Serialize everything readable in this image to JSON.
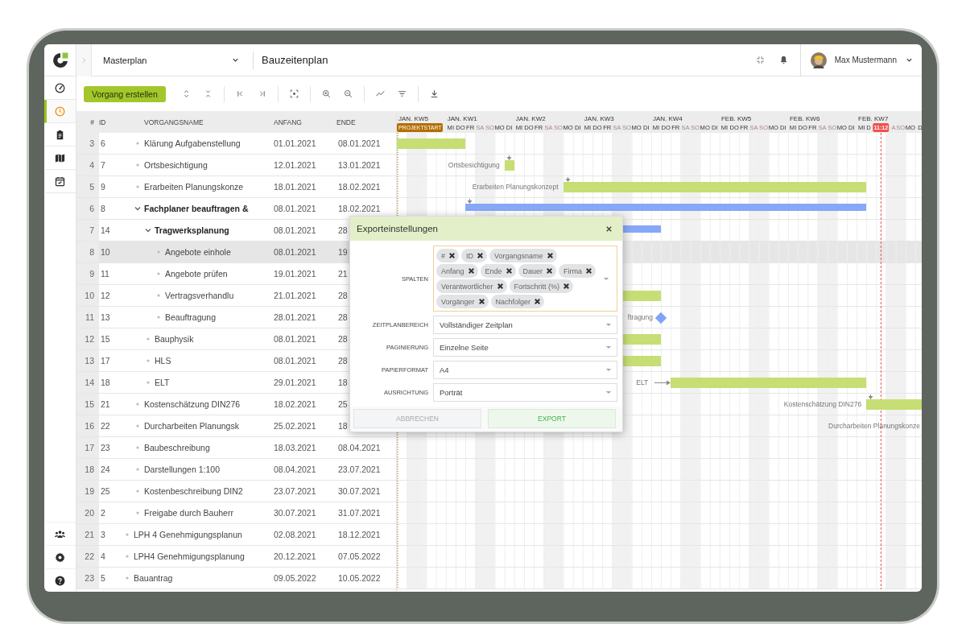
{
  "nav": {
    "top": [
      {
        "selected": false
      },
      {
        "selected": true
      },
      {
        "selected": false
      },
      {
        "selected": false
      },
      {
        "selected": false
      }
    ],
    "bottom": [
      {
        "selected": false
      },
      {
        "selected": false
      },
      {
        "selected": false
      }
    ]
  },
  "topbar": {
    "project": "Masterplan",
    "title": "Bauzeitenplan",
    "user": "Max Mustermann"
  },
  "toolbar": {
    "create_button": "Vorgang erstellen"
  },
  "table": {
    "columns": [
      "#",
      "ID",
      "VORGANGSNAME",
      "ANFANG",
      "ENDE"
    ],
    "rows": [
      {
        "children": [
          {
            "number": "3",
            "id": "6",
            "name": "Klärung Aufgabenstellung",
            "start": "01.01.2021",
            "end": "08.01.2021",
            "selected": false
          },
          {
            "number": "4",
            "id": "7",
            "name": "Ortsbesichtigung",
            "start": "12.01.2021",
            "end": "13.01.2021",
            "selected": false,
            "bar_label": "Ortsbesichtigung",
            "arrow_from_above": true
          },
          {
            "number": "5",
            "id": "9",
            "name": "Erarbeiten Planungskonze",
            "start": "18.01.2021",
            "end": "18.02.2021",
            "selected": false,
            "bar_label": "Erarbeiten Planungskonzept",
            "arrow_from_above": true
          },
          {
            "number": "6",
            "id": "8",
            "name": "Fachplaner beauftragen &",
            "start": "08.01.2021",
            "end": "18.02.2021",
            "selected": false,
            "expanded": true,
            "arrow_from_above": true,
            "children": [
              {
                "number": "7",
                "id": "14",
                "name": "Tragwerksplanung",
                "start": "08.01.2021",
                "end": "28",
                "selected": false,
                "expanded": true,
                "children": [
                  {
                    "number": "8",
                    "id": "10",
                    "name": "Angebote einhole",
                    "start": "08.01.2021",
                    "end": "19",
                    "selected": true
                  },
                  {
                    "number": "9",
                    "id": "11",
                    "name": "Angebote prüfen",
                    "start": "19.01.2021",
                    "end": "21",
                    "selected": false
                  },
                  {
                    "number": "10",
                    "id": "12",
                    "name": "Vertragsverhandlu",
                    "start": "21.01.2021",
                    "end": "28",
                    "selected": false
                  },
                  {
                    "number": "11",
                    "id": "13",
                    "name": "Beauftragung",
                    "start": "28.01.2021",
                    "end": "28",
                    "selected": false,
                    "bar_label": "ftragung"
                  }
                ]
              },
              {
                "number": "12",
                "id": "15",
                "name": "Bauphysik",
                "start": "08.01.2021",
                "end": "28",
                "selected": false
              },
              {
                "number": "13",
                "id": "17",
                "name": "HLS",
                "start": "08.01.2021",
                "end": "28",
                "selected": false
              },
              {
                "number": "14",
                "id": "18",
                "name": "ELT",
                "start": "29.01.2021",
                "end": "18",
                "selected": false,
                "bar_label": "ELT",
                "arrow_from_left": true
              }
            ]
          },
          {
            "number": "15",
            "id": "21",
            "name": "Kostenschätzung DIN276",
            "start": "18.02.2021",
            "end": "25",
            "selected": false,
            "bar_label": "Kostenschätzung DIN276",
            "arrow_from_above": true
          },
          {
            "number": "16",
            "id": "22",
            "name": "Durcharbeiten Planungsk",
            "start": "25.02.2021",
            "end": "18",
            "selected": false,
            "bar_label": "Durcharbeiten Planungskonze"
          },
          {
            "number": "17",
            "id": "23",
            "name": "Baubeschreibung",
            "start": "18.03.2021",
            "end": "08.04.2021",
            "selected": false
          },
          {
            "number": "18",
            "id": "24",
            "name": "Darstellungen 1:100",
            "start": "08.04.2021",
            "end": "23.07.2021",
            "selected": false
          },
          {
            "number": "19",
            "id": "25",
            "name": "Kostenbeschreibung DIN2",
            "start": "23.07.2021",
            "end": "30.07.2021",
            "selected": false
          },
          {
            "number": "20",
            "id": "2",
            "name": "Freigabe durch Bauherr",
            "start": "30.07.2021",
            "end": "31.07.2021",
            "selected": false
          }
        ]
      },
      {
        "number": "21",
        "id": "3",
        "name": "LPH 4 Genehmigungsplanun",
        "start": "02.08.2021",
        "end": "18.12.2021",
        "selected": false
      },
      {
        "number": "22",
        "id": "4",
        "name": "LPH4 Genehmigungsplanung",
        "start": "20.12.2021",
        "end": "07.05.2022",
        "selected": false
      },
      {
        "number": "23",
        "id": "5",
        "name": "Bauantrag",
        "start": "09.05.2022",
        "end": "10.05.2022",
        "selected": false
      }
    ]
  },
  "timeline": {
    "weeks": [
      {
        "label": "JAN. KW5",
        "partial": true,
        "days": [
          {
            "kind": "marker",
            "label": "PROJEKTSTART",
            "color": "#b36e00"
          }
        ]
      },
      {
        "label": "JAN. KW1",
        "days": [
          {
            "label": "MI",
            "weekend": false
          },
          {
            "label": "DO",
            "weekend": false
          },
          {
            "label": "FR",
            "weekend": false
          },
          {
            "label": "SA",
            "weekend": true
          },
          {
            "label": "SO",
            "weekend": true
          },
          {
            "label": "MO",
            "weekend": false
          },
          {
            "label": "DI",
            "weekend": false
          }
        ]
      },
      {
        "label": "JAN. KW2",
        "days": [
          {
            "label": "MI",
            "weekend": false
          },
          {
            "label": "DO",
            "weekend": false
          },
          {
            "label": "FR",
            "weekend": false
          },
          {
            "label": "SA",
            "weekend": true
          },
          {
            "label": "SO",
            "weekend": true
          },
          {
            "label": "MO",
            "weekend": false
          },
          {
            "label": "DI",
            "weekend": false
          }
        ]
      },
      {
        "label": "JAN. KW3",
        "days": [
          {
            "label": "MI",
            "weekend": false
          },
          {
            "label": "DO",
            "weekend": false
          },
          {
            "label": "FR",
            "weekend": false
          },
          {
            "label": "SA",
            "weekend": true
          },
          {
            "label": "SO",
            "weekend": true
          },
          {
            "label": "MO",
            "weekend": false
          },
          {
            "label": "DI",
            "weekend": false
          }
        ]
      },
      {
        "label": "JAN. KW4",
        "days": [
          {
            "label": "MI",
            "weekend": false
          },
          {
            "label": "DO",
            "weekend": false
          },
          {
            "label": "FR",
            "weekend": false
          },
          {
            "label": "SA",
            "weekend": true
          },
          {
            "label": "SO",
            "weekend": true
          },
          {
            "label": "MO",
            "weekend": false
          },
          {
            "label": "DI",
            "weekend": false
          }
        ]
      },
      {
        "label": "FEB. KW5",
        "days": [
          {
            "label": "MI",
            "weekend": false
          },
          {
            "label": "DO",
            "weekend": false
          },
          {
            "label": "FR",
            "weekend": false
          },
          {
            "label": "SA",
            "weekend": true
          },
          {
            "label": "SO",
            "weekend": true
          },
          {
            "label": "MO",
            "weekend": false
          },
          {
            "label": "DI",
            "weekend": false
          }
        ]
      },
      {
        "label": "FEB. KW6",
        "days": [
          {
            "label": "MI",
            "weekend": false
          },
          {
            "label": "DO",
            "weekend": false
          },
          {
            "label": "FR",
            "weekend": false
          },
          {
            "label": "SA",
            "weekend": true
          },
          {
            "label": "SO",
            "weekend": true
          },
          {
            "label": "MO",
            "weekend": false
          },
          {
            "label": "DI",
            "weekend": false
          }
        ]
      },
      {
        "label": "FEB. KW7",
        "days": [
          {
            "label": "MI",
            "weekend": false
          },
          {
            "label": "D",
            "weekend": false
          },
          {
            "kind": "marker",
            "label": "11:12",
            "color": "#f0504d"
          },
          {
            "label": "A",
            "weekend": true
          },
          {
            "label": "SO",
            "weekend": true
          },
          {
            "label": "MO",
            "weekend": false
          },
          {
            "label": "D",
            "weekend": false
          }
        ]
      }
    ]
  },
  "dialog": {
    "title": "Exporteinstellungen",
    "fields": [
      {
        "kind": "chips",
        "label": "SPALTEN",
        "chips": [
          "#",
          "ID",
          "Vorgangsname",
          "Anfang",
          "Ende",
          "Dauer",
          "Firma",
          "Verantwortlicher",
          "Fortschritt (%)",
          "Vorgänger",
          "Nachfolger"
        ]
      },
      {
        "kind": "select",
        "label": "ZEITPLANBEREICH",
        "value": "Vollständiger Zeitplan"
      },
      {
        "kind": "select",
        "label": "PAGINIERUNG",
        "value": "Einzelne Seite"
      },
      {
        "kind": "select",
        "label": "PAPIERFORMAT",
        "value": "A4"
      },
      {
        "kind": "select",
        "label": "AUSRICHTUNG",
        "value": "Porträt"
      }
    ],
    "buttons": [
      {
        "label": "ABBRECHEN",
        "kind": "secondary"
      },
      {
        "label": "EXPORT",
        "kind": "primary"
      }
    ]
  }
}
